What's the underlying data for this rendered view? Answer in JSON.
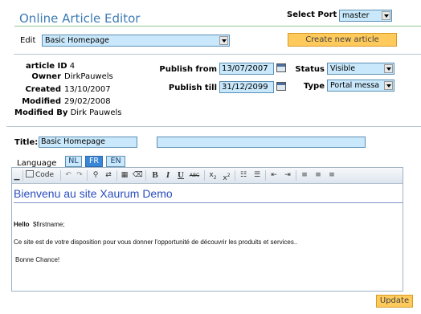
{
  "header": {
    "title": "Online Article Editor",
    "port_label": "Select Port",
    "port_value": "master"
  },
  "edit": {
    "label": "Edit",
    "selected_article": "Basic Homepage",
    "create_button": "Create new article"
  },
  "meta": {
    "article_id_label": "article ID",
    "article_id": "4",
    "owner_label": "Owner",
    "owner": "DirkPauwels",
    "created_label": "Created",
    "created": "13/10/2007",
    "modified_label": "Modified",
    "modified": "29/02/2008",
    "modified_by_label": "Modified By",
    "modified_by": "Dirk Pauwels"
  },
  "publish": {
    "from_label": "Publish from",
    "from": "13/07/2007",
    "till_label": "Publish till",
    "till": "31/12/2099",
    "status_label": "Status",
    "status": "Visible",
    "type_label": "Type",
    "type": "Portal messa"
  },
  "title": {
    "label": "Title:",
    "value": "Basic Homepage",
    "secondary_value": ""
  },
  "language": {
    "label": "Language",
    "tabs": [
      "NL",
      "FR",
      "EN"
    ],
    "active": "FR"
  },
  "toolbar": {
    "code_label": "Code",
    "bold": "B",
    "italic": "I",
    "underline": "U",
    "strike": "ABC",
    "subscript": "x",
    "superscript": "x"
  },
  "content": {
    "heading": "Bienvenu au site Xaurum Demo",
    "hello_label": "Hello",
    "hello_var": "$firstname;",
    "paragraph": "Ce site est de votre disposition pour vous donner l'opportunité de découvrir les produits et services..",
    "closing": "Bonne Chance!"
  },
  "footer": {
    "update_button": "Update"
  },
  "colors": {
    "accent": "#3d7bb5",
    "input_bg": "#c9e8fb",
    "button_bg": "#ffca5c",
    "active_tab": "#3a86d6"
  }
}
